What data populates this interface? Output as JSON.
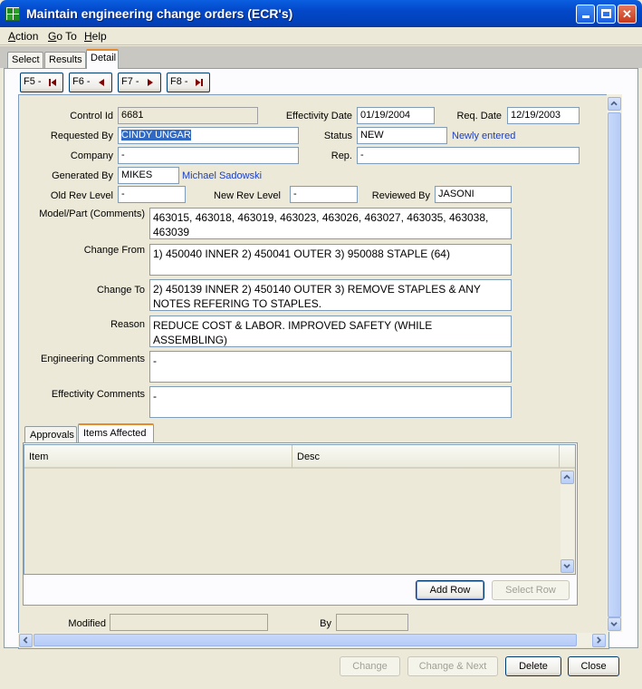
{
  "window": {
    "title": "Maintain engineering change orders (ECR's)"
  },
  "menu": [
    {
      "key": "A",
      "rest": "ction"
    },
    {
      "key": "G",
      "rest": "o To"
    },
    {
      "key": "H",
      "rest": "elp"
    }
  ],
  "tabs": {
    "select": "Select",
    "results": "Results",
    "detail": "Detail"
  },
  "nav": {
    "f5": "F5 -",
    "f6": "F6 -",
    "f7": "F7 -",
    "f8": "F8 -"
  },
  "form": {
    "control_id_label": "Control Id",
    "control_id": "6681",
    "effectivity_date_label": "Effectivity Date",
    "effectivity_date": "01/19/2004",
    "req_date_label": "Req. Date",
    "req_date": "12/19/2003",
    "requested_by_label": "Requested By",
    "requested_by": "CINDY UNGAR",
    "status_label": "Status",
    "status": "NEW",
    "status_desc": "Newly entered",
    "company_label": "Company",
    "company": "-",
    "rep_label": "Rep.",
    "rep": "-",
    "generated_by_label": "Generated By",
    "generated_by": "MIKES",
    "generated_by_name": "Michael Sadowski",
    "old_rev_label": "Old Rev Level",
    "old_rev": "-",
    "new_rev_label": "New Rev Level",
    "new_rev": "-",
    "reviewed_by_label": "Reviewed By",
    "reviewed_by": "JASONI",
    "model_part_label": "Model/Part (Comments)",
    "model_part": "463015, 463018, 463019, 463023, 463026, 463027, 463035, 463038, 463039",
    "change_from_label": "Change From",
    "change_from": "1) 450040 INNER  2) 450041 OUTER   3) 950088 STAPLE (64)",
    "change_to_label": "Change To",
    "change_to": "2) 450139 INNER   2) 450140 OUTER   3) REMOVE STAPLES & ANY NOTES REFERING TO STAPLES.",
    "reason_label": "Reason",
    "reason": "REDUCE COST & LABOR. IMPROVED SAFETY (WHILE ASSEMBLING)",
    "eng_comments_label": "Engineering Comments",
    "eng_comments": "-",
    "eff_comments_label": "Effectivity Comments",
    "eff_comments": "-",
    "modified_label": "Modified",
    "modified": "",
    "by_label": "By",
    "by": ""
  },
  "inner_tabs": {
    "approvals": "Approvals",
    "items_affected": "Items Affected"
  },
  "grid": {
    "columns": [
      "Item",
      "Desc"
    ]
  },
  "grid_buttons": {
    "add_row": "Add Row",
    "select_row": "Select Row"
  },
  "footer": {
    "change": "Change",
    "change_next": "Change & Next",
    "delete": "Delete",
    "close": "Close"
  }
}
